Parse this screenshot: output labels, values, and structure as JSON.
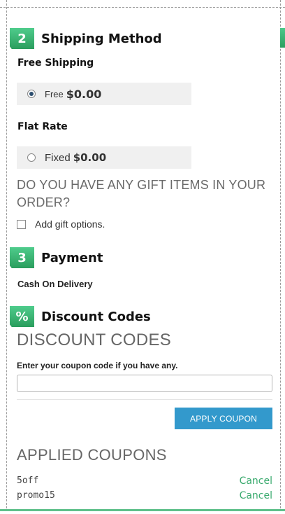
{
  "shipping": {
    "step_number": "2",
    "title": "Shipping Method",
    "methods": [
      {
        "title": "Free Shipping",
        "rate_label": "Free",
        "price": "$0.00",
        "selected": true
      },
      {
        "title": "Flat Rate",
        "rate_label": "Fixed",
        "price": "$0.00",
        "selected": false
      }
    ]
  },
  "gift": {
    "heading": "DO YOU HAVE ANY GIFT ITEMS IN YOUR ORDER?",
    "checkbox_label": "Add gift options."
  },
  "payment": {
    "step_number": "3",
    "title": "Payment",
    "method": "Cash On Delivery"
  },
  "discount": {
    "step_symbol": "%",
    "title": "Discount Codes",
    "heading": "DISCOUNT CODES",
    "input_label": "Enter your coupon code if you have any.",
    "input_value": "",
    "apply_button": "APPLY COUPON",
    "applied_heading": "APPLIED COUPONS",
    "applied": [
      {
        "code": "5off",
        "action": "Cancel"
      },
      {
        "code": "promo15",
        "action": "Cancel"
      }
    ]
  },
  "colors": {
    "accent_green": "#3aaa6e",
    "button_blue": "#3399cc"
  }
}
